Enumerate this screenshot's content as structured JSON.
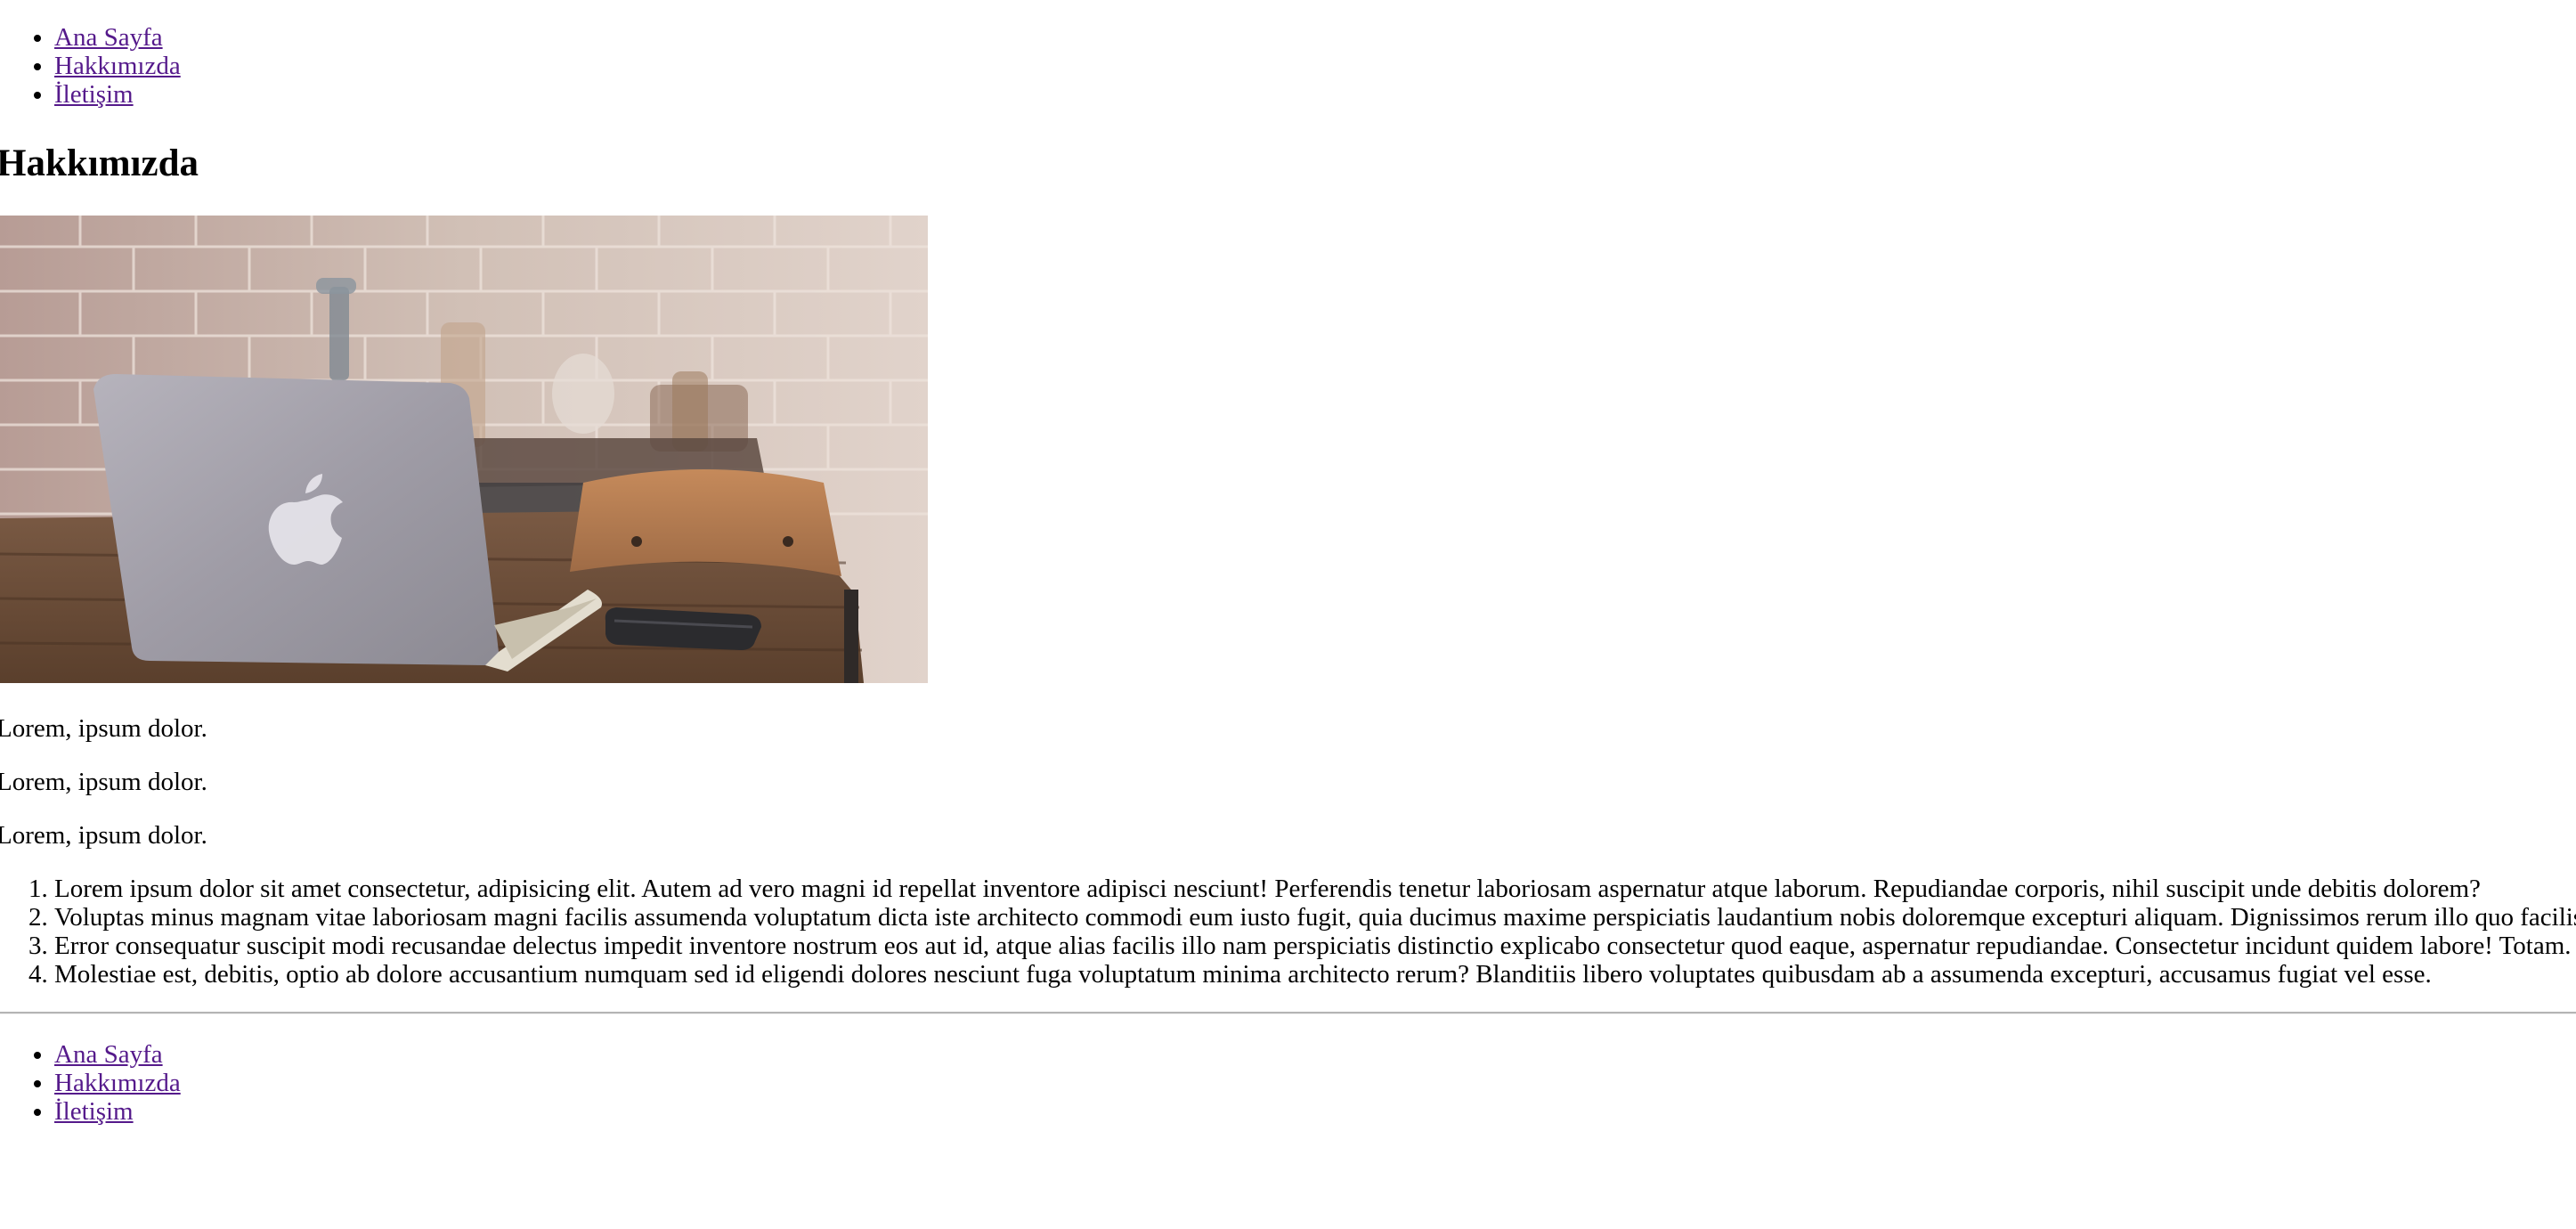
{
  "nav_top": {
    "items": [
      {
        "label": "Ana Sayfa"
      },
      {
        "label": "Hakkımızda"
      },
      {
        "label": "İletişim"
      }
    ]
  },
  "main": {
    "title": "Hakkımızda",
    "image": {
      "icon": "laptop-desk-photo"
    },
    "paragraphs": [
      "Lorem, ipsum dolor.",
      "Lorem, ipsum dolor.",
      "Lorem, ipsum dolor."
    ],
    "ordered_list": [
      "Lorem ipsum dolor sit amet consectetur, adipisicing elit. Autem ad vero magni id repellat inventore adipisci nesciunt! Perferendis tenetur laboriosam aspernatur atque laborum. Repudiandae corporis, nihil suscipit unde debitis dolorem?",
      "Voluptas minus magnam vitae laboriosam magni facilis assumenda voluptatum dicta iste architecto commodi eum iusto fugit, quia ducimus maxime perspiciatis laudantium nobis doloremque excepturi aliquam. Dignissimos rerum illo quo facilis!",
      "Error consequatur suscipit modi recusandae delectus impedit inventore nostrum eos aut id, atque alias facilis illo nam perspiciatis distinctio explicabo consectetur quod eaque, aspernatur repudiandae. Consectetur incidunt quidem labore! Totam.",
      "Molestiae est, debitis, optio ab dolore accusantium numquam sed id eligendi dolores nesciunt fuga voluptatum minima architecto rerum? Blanditiis libero voluptates quibusdam ab a assumenda excepturi, accusamus fugiat vel esse."
    ]
  },
  "nav_bottom": {
    "items": [
      {
        "label": "Ana Sayfa"
      },
      {
        "label": "Hakkımızda"
      },
      {
        "label": "İletişim"
      }
    ]
  },
  "colors": {
    "link": "#551a8b",
    "text": "#000000",
    "background": "#ffffff"
  }
}
